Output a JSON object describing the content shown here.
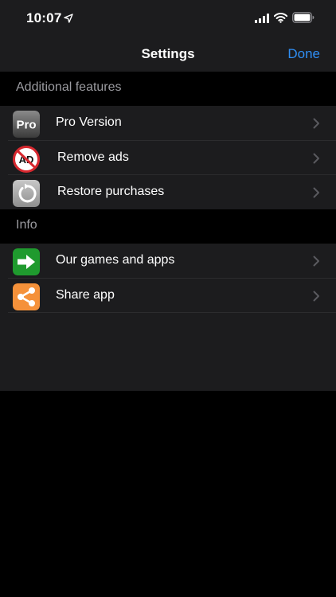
{
  "status_bar": {
    "time": "10:07"
  },
  "nav": {
    "title": "Settings",
    "done_label": "Done"
  },
  "sections": [
    {
      "header": "Additional features",
      "items": [
        {
          "label": "Pro Version",
          "icon": "pro-icon",
          "icon_text": "Pro"
        },
        {
          "label": "Remove ads",
          "icon": "no-ads-icon",
          "icon_text": "AD"
        },
        {
          "label": "Restore purchases",
          "icon": "restore-icon"
        }
      ]
    },
    {
      "header": "Info",
      "items": [
        {
          "label": "Our games and apps",
          "icon": "arrow-right-icon"
        },
        {
          "label": "Share app",
          "icon": "share-icon"
        }
      ]
    }
  ],
  "colors": {
    "accent": "#2f8ef4",
    "background": "#000000",
    "grouped_row": "#1c1c1e",
    "section_text": "#9b9ba0",
    "games_icon": "#1f9a2e",
    "share_icon": "#f5913a",
    "ads_red": "#d7282f"
  }
}
